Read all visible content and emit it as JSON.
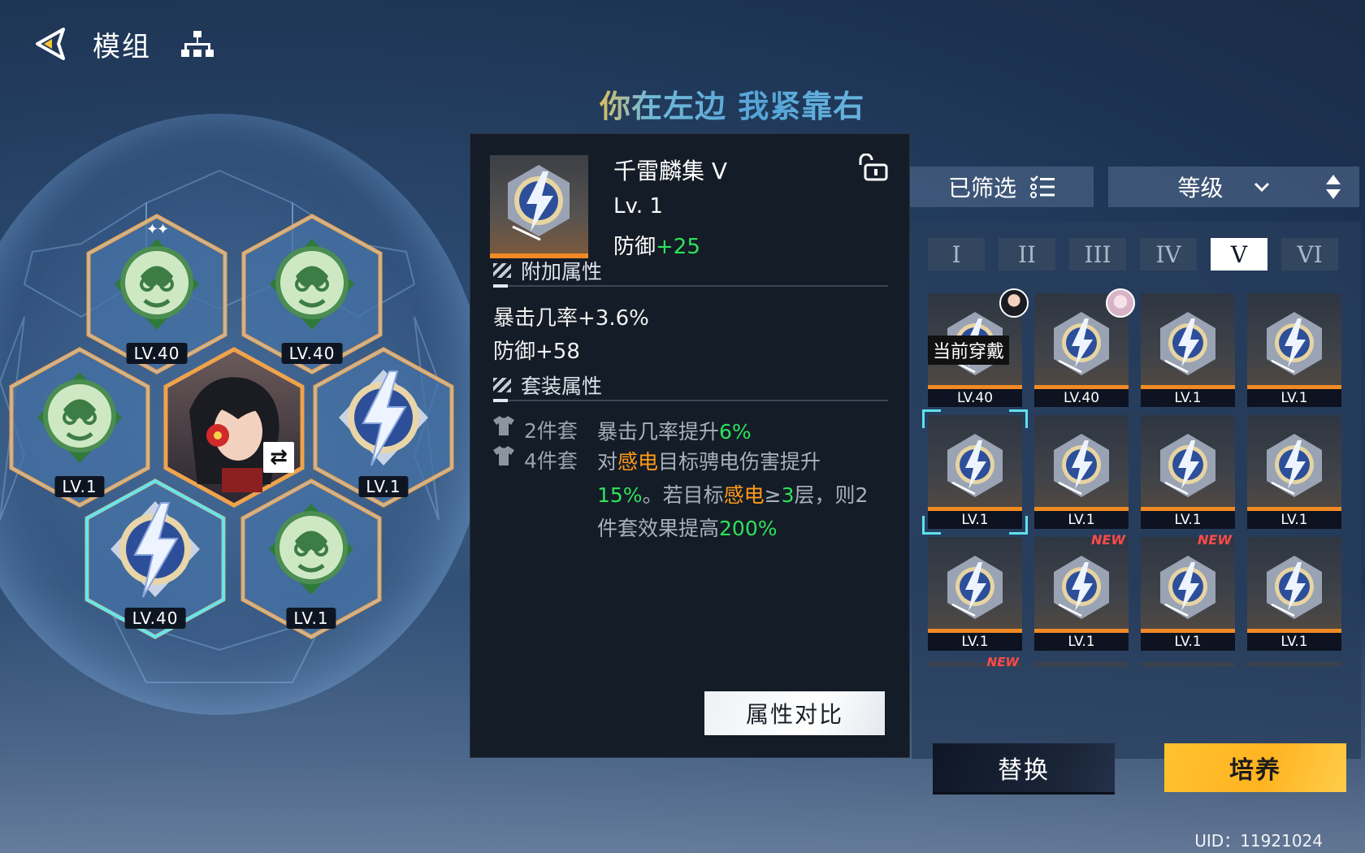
{
  "header": {
    "title": "模组",
    "slogan": "你在左边 我紧靠右"
  },
  "sphere": {
    "slots": [
      {
        "level": "LV.40",
        "type": "green-emblem",
        "sparkle": "✦✦"
      },
      {
        "level": "LV.40",
        "type": "green-emblem"
      },
      {
        "level": "LV.1",
        "type": "green-emblem"
      },
      {
        "level": "",
        "type": "character",
        "swap_icon": "⇄"
      },
      {
        "level": "LV.1",
        "type": "thunder-emblem"
      },
      {
        "level": "LV.40",
        "type": "thunder-emblem"
      },
      {
        "level": "LV.1",
        "type": "green-emblem"
      }
    ]
  },
  "detail": {
    "name": "千雷麟集 V",
    "level": "Lv. 1",
    "main_stat_label": "防御",
    "main_stat_value": "+25",
    "extra_title": "附加属性",
    "extra_attrs": [
      "暴击几率+3.6%",
      "防御+58"
    ],
    "set_title": "套装属性",
    "set2_label": "2件套",
    "set2_text": "暴击几率提升",
    "set2_value": "6%",
    "set4_label": "4件套",
    "set4_parts": {
      "p1": "对",
      "k1": "感电",
      "p2": "目标骋电伤害提升",
      "v1": "15%",
      "p3": "。若目标",
      "k2": "感电",
      "p4": "≥",
      "v2": "3",
      "p5": "层，则2件套效果提高",
      "v3": "200%"
    },
    "compare_button": "属性对比"
  },
  "right_panel": {
    "filter_label": "已筛选",
    "sort_label": "等级",
    "tabs": [
      "I",
      "II",
      "III",
      "IV",
      "V",
      "VI"
    ],
    "active_tab": "V",
    "cells": [
      {
        "level": "LV.40",
        "wearing": "当前穿戴",
        "avatar": "dark"
      },
      {
        "level": "LV.40",
        "avatar": "pink"
      },
      {
        "level": "LV.1"
      },
      {
        "level": "LV.1"
      },
      {
        "level": "LV.1",
        "selected": true
      },
      {
        "level": "LV.1"
      },
      {
        "level": "LV.1"
      },
      {
        "level": "LV.1"
      },
      {
        "level": "LV.1"
      },
      {
        "level": "LV.1",
        "new": "NEW"
      },
      {
        "level": "LV.1",
        "new": "NEW"
      },
      {
        "level": "LV.1"
      }
    ],
    "peek_new": "NEW",
    "replace_button": "替换",
    "train_button": "培养"
  },
  "footer": {
    "uid": "UID：11921024"
  },
  "colors": {
    "accent_orange": "#f08a24",
    "select_cyan": "#5fe0ef",
    "highlight_green": "#2ee25a",
    "keyword_orange": "#ff9a1a",
    "train_yellow": "#ffc32e"
  }
}
